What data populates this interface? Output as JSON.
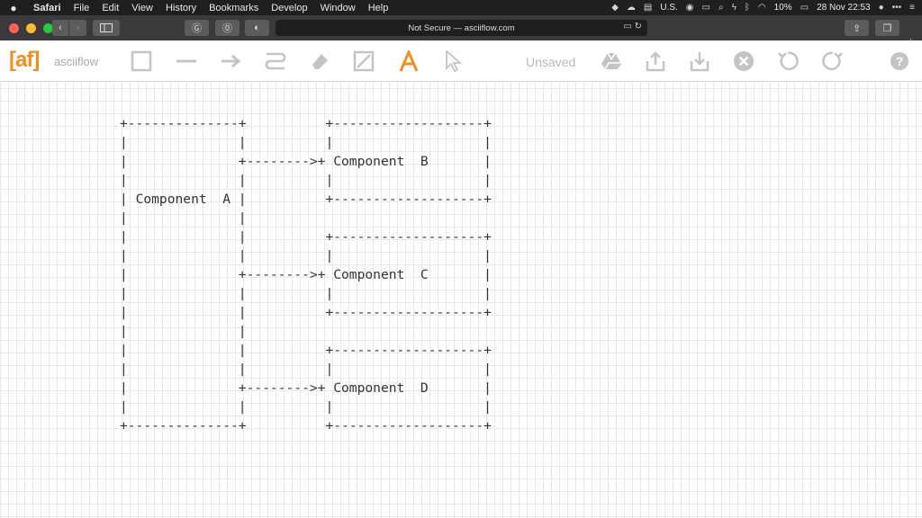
{
  "menubar": {
    "apple": "",
    "items": [
      "Safari",
      "File",
      "Edit",
      "View",
      "History",
      "Bookmarks",
      "Develop",
      "Window",
      "Help"
    ],
    "input_source": "U.S.",
    "battery": "10%",
    "datetime": "28 Nov  22:53"
  },
  "browser": {
    "address": "Not Secure — asciiflow.com"
  },
  "app": {
    "logo": "[af]",
    "name": "asciiflow",
    "status": "Unsaved",
    "accent": "#f1901d",
    "tools": [
      "box-tool",
      "line-tool",
      "arrow-tool",
      "freeform-tool",
      "erase-tool",
      "resize-tool",
      "text-tool",
      "select-tool"
    ],
    "actions": [
      "drive-icon",
      "export-icon",
      "import-icon",
      "clear-icon",
      "undo-icon",
      "redo-icon",
      "help-icon"
    ]
  },
  "diagram": {
    "text": "+--------------+          +-------------------+\n|              |          |                   |\n|              +-------->+ Component  B       |\n|              |          |                   |\n| Component  A |          +-------------------+\n|              |\n|              |          +-------------------+\n|              |          |                   |\n|              +-------->+ Component  C       |\n|              |          |                   |\n|              |          +-------------------+\n|              |\n|              |          +-------------------+\n|              |          |                   |\n|              +-------->+ Component  D       |\n|              |          |                   |\n+--------------+          +-------------------+"
  }
}
